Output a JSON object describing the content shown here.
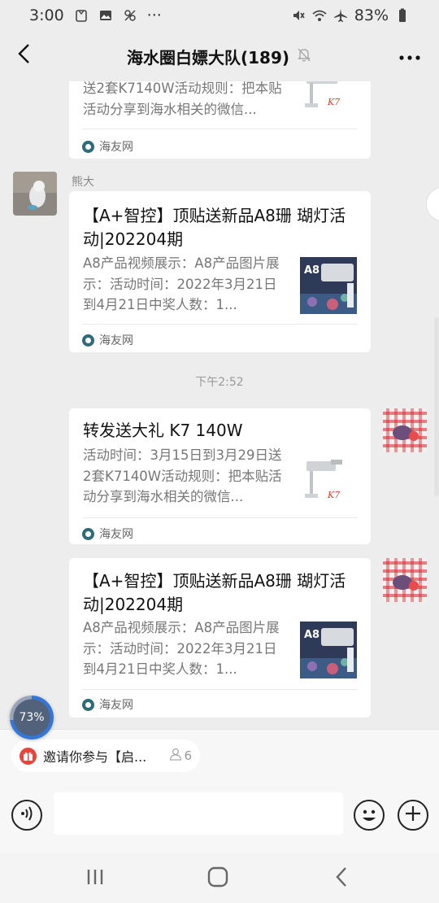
{
  "status_bar": {
    "time": "3:00",
    "dots": "···",
    "battery": "83%"
  },
  "header": {
    "title": "海水圈白嫖大队(189)"
  },
  "messages": {
    "top_partial": {
      "desc": "送2套K7140W活动规则：把本贴活动分享到海水相关的微信...",
      "source": "海友网"
    },
    "bear": {
      "sender": "熊大",
      "title": "【A+智控】顶贴送新品A8珊 瑚灯活动|202204期",
      "desc": "A8产品视频展示：A8产品图片展示：活动时间：2022年3月21日到4月21日中奖人数：1...",
      "source": "海友网"
    },
    "timestamp": "下午2:52",
    "mine_1": {
      "title": "转发送大礼  K7 140W",
      "desc": "活动时间：3月15日到3月29日送2套K7140W活动规则：把本贴活动分享到海水相关的微信...",
      "source": "海友网"
    },
    "mine_2": {
      "title": "【A+智控】顶贴送新品A8珊 瑚灯活动|202204期",
      "desc": "A8产品视频展示：A8产品图片展示：活动时间：2022年3月21日到4月21日中奖人数：1...",
      "source": "海友网"
    }
  },
  "thumbs": {
    "a8_label": "A8",
    "k7_label": "K7"
  },
  "progress": {
    "percent": "73%",
    "value": 0.73
  },
  "pinned": {
    "text": "邀请你参与【启...",
    "count": "6"
  },
  "input": {
    "placeholder": ""
  },
  "colors": {
    "background": "#ededed",
    "card": "#ffffff",
    "muted_text": "#777777",
    "source_logo": "#2c6c7a",
    "progress_ring": "#3477d8",
    "pinned_icon": "#e8453c"
  }
}
